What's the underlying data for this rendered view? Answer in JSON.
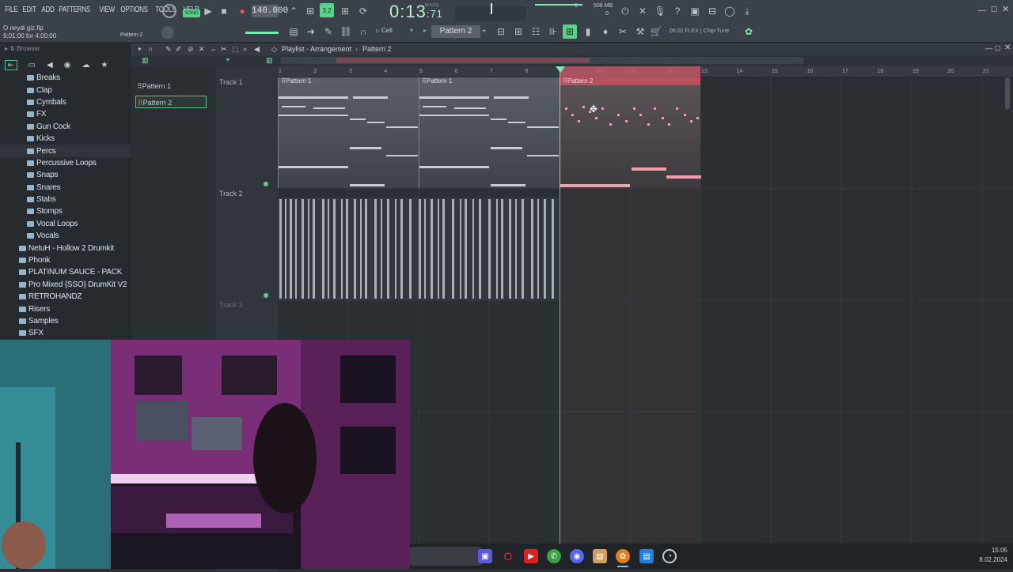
{
  "menu": [
    "FILE",
    "EDIT",
    "ADD",
    "PATTERNS",
    "VIEW",
    "OPTIONS",
    "TOOLS",
    "HELP"
  ],
  "transport": {
    "mode_label": "SONG",
    "tempo": "140.000",
    "time_main": "0:13",
    "time_sub": ":71",
    "time_unit": "M:S:CS",
    "memory": "508 MB",
    "cpu_count": "6",
    "voices": "0"
  },
  "hint": {
    "line1": "O neydi giz.flp",
    "line2": "9:01:00 for 4:00:00",
    "pattern_hint": "Pattern 2"
  },
  "toolbar2": {
    "pattern_selector": "Pattern 2",
    "snap": "Cell",
    "plugin_info": "06:02  FLEX | Chip-Tune"
  },
  "browser": {
    "title": "Browser",
    "items": [
      {
        "label": "Breaks",
        "level": "sub"
      },
      {
        "label": "Clap",
        "level": "sub"
      },
      {
        "label": "Cymbals",
        "level": "sub"
      },
      {
        "label": "FX",
        "level": "sub"
      },
      {
        "label": "Gun Cock",
        "level": "sub"
      },
      {
        "label": "Kicks",
        "level": "sub"
      },
      {
        "label": "Percs",
        "level": "sub",
        "highlight": true
      },
      {
        "label": "Percussive Loops",
        "level": "sub"
      },
      {
        "label": "Snaps",
        "level": "sub"
      },
      {
        "label": "Snares",
        "level": "sub"
      },
      {
        "label": "Stabs",
        "level": "sub"
      },
      {
        "label": "Stomps",
        "level": "sub"
      },
      {
        "label": "Vocal Loops",
        "level": "sub"
      },
      {
        "label": "Vocals",
        "level": "sub"
      },
      {
        "label": "NetuH - Hollow 2 Drumkit",
        "level": "top"
      },
      {
        "label": "Phonk",
        "level": "top"
      },
      {
        "label": "PLATINUM SAUCE - PACK",
        "level": "top"
      },
      {
        "label": "Pro Mixed {SSO} DrumKit V2",
        "level": "top"
      },
      {
        "label": "RETROHANDZ",
        "level": "top"
      },
      {
        "label": "Risers",
        "level": "top"
      },
      {
        "label": "Samples",
        "level": "top"
      },
      {
        "label": "SFX",
        "level": "top"
      }
    ]
  },
  "playlist": {
    "title": "Playlist - Arrangement",
    "current_pattern": "Pattern 2",
    "patterns": [
      "Pattern 1",
      "Pattern 2"
    ],
    "tracks": [
      "Track 1",
      "Track 2",
      "Track 3"
    ],
    "clip_labels": [
      "Pattern 1",
      "Pattern 1",
      "Pattern 2"
    ],
    "ruler": [
      "1",
      "2",
      "3",
      "4",
      "5",
      "6",
      "7",
      "8",
      "9",
      "10",
      "11",
      "12",
      "13",
      "14",
      "15",
      "16",
      "17",
      "18",
      "19",
      "20",
      "21"
    ]
  },
  "clock": {
    "time": "15:05",
    "date": "8.02.2024"
  },
  "colors": {
    "accent": "#7fe8b0",
    "pattern2": "#e0909a",
    "bg": "#2b3035"
  }
}
